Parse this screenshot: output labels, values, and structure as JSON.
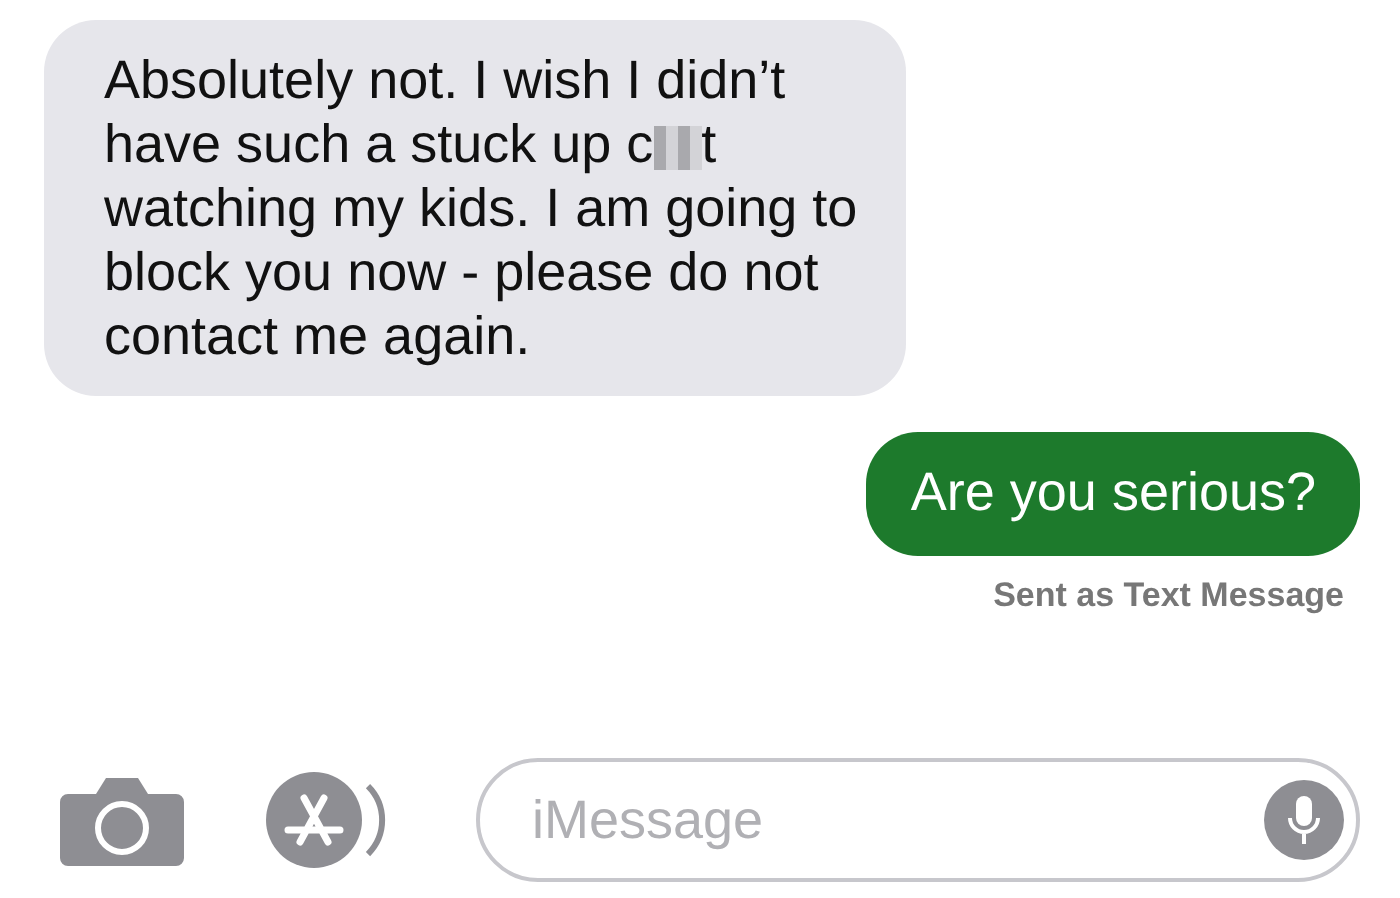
{
  "messages": [
    {
      "outgoing": false,
      "lines": [
        {
          "text": "Absolutely not. I wish I didn’t"
        },
        {
          "text": "have such a stuck up c",
          "censored": true,
          "tail": "t"
        },
        {
          "text": "watching my kids. I am going to"
        },
        {
          "text": "block you now - please do not"
        },
        {
          "text": "contact me again."
        }
      ]
    },
    {
      "outgoing": true,
      "lines": [
        {
          "text": "Are you serious?"
        }
      ],
      "status": "Sent as Text Message"
    }
  ],
  "composer": {
    "placeholder": "iMessage"
  }
}
